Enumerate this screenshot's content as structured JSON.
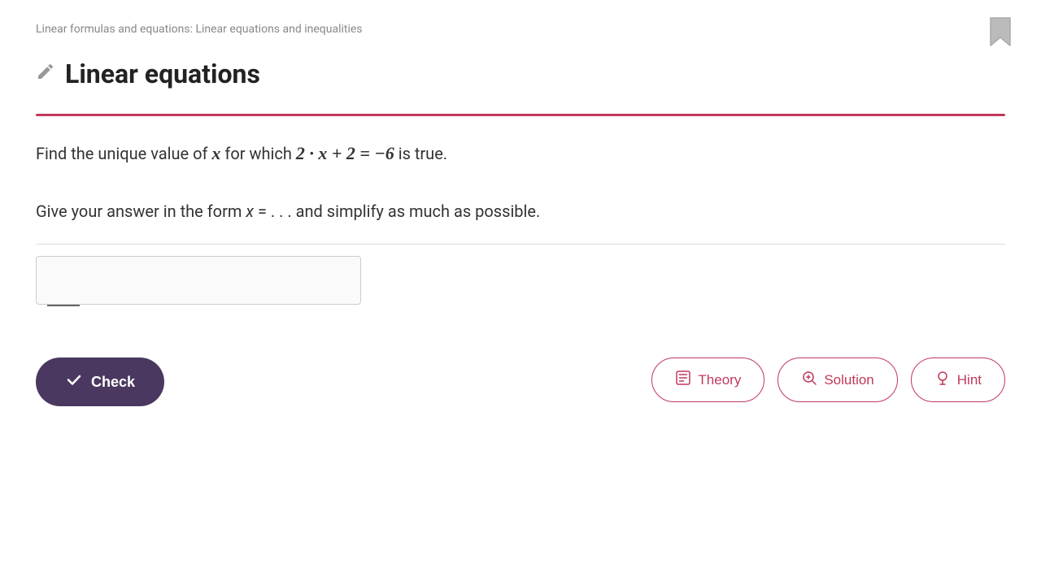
{
  "breadcrumb": {
    "text": "Linear formulas and equations: Linear equations and inequalities"
  },
  "page_title": "Linear equations",
  "problem": {
    "line1_prefix": "Find the unique value of ",
    "line1_var": "x",
    "line1_mid": " for which ",
    "line1_equation": "2 · x + 2 = −6",
    "line1_suffix": " is true.",
    "line2_prefix": "Give your answer in the form ",
    "line2_form": "x = . . .",
    "line2_suffix": " and simplify as much as possible."
  },
  "answer": {
    "placeholder": ""
  },
  "buttons": {
    "check": "Check",
    "theory": "Theory",
    "solution": "Solution",
    "hint": "Hint"
  },
  "colors": {
    "accent": "#c0395a",
    "button_bg": "#4a3860",
    "bookmark": "#bbbbbb"
  }
}
